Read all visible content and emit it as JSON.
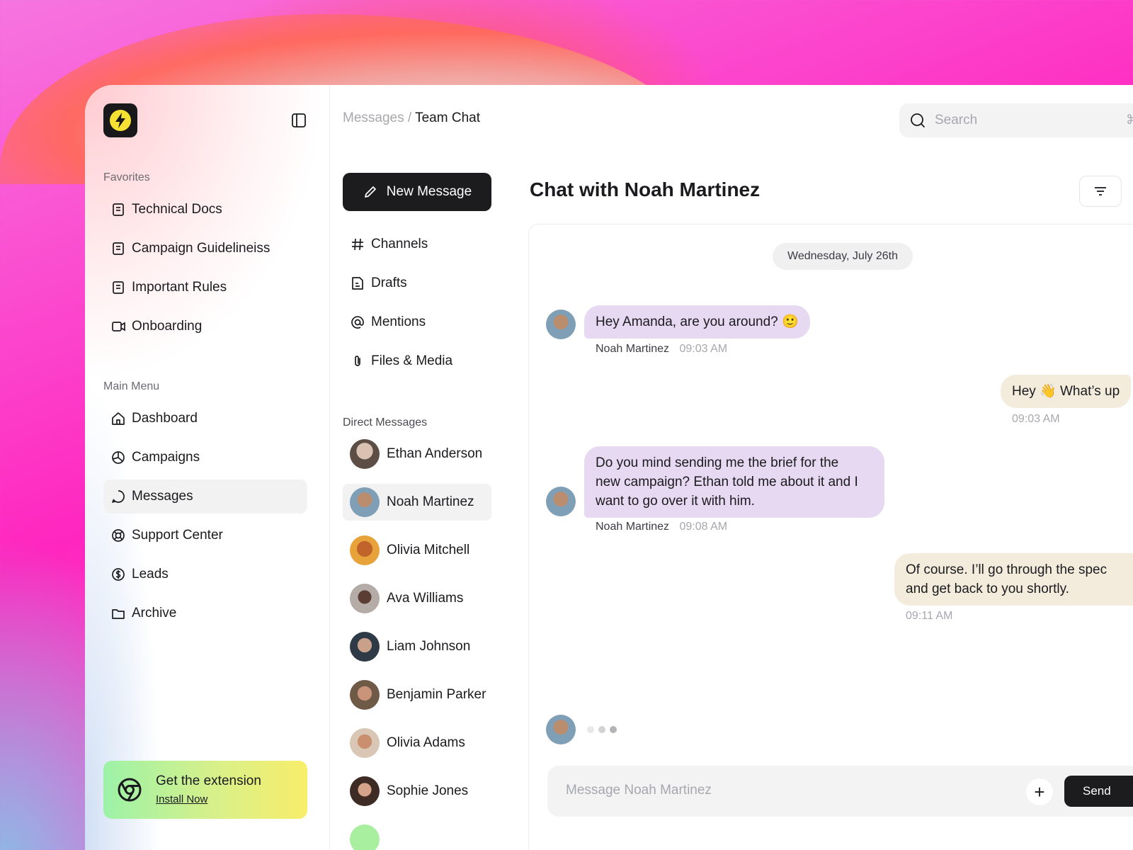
{
  "app": {
    "brand_colors": {
      "accent": "#1c1c1e",
      "logo_bolt": "#f7e233",
      "incoming_bubble": "#e7d9f1",
      "outgoing_bubble": "#f3ecdc"
    }
  },
  "sidebar": {
    "favorites_label": "Favorites",
    "favorites": [
      {
        "label": "Technical Docs",
        "icon": "document-icon"
      },
      {
        "label": "Campaign Guidelineiss",
        "icon": "document-icon"
      },
      {
        "label": "Important Rules",
        "icon": "document-icon"
      },
      {
        "label": "Onboarding",
        "icon": "video-icon"
      }
    ],
    "main_menu_label": "Main Menu",
    "main_menu": [
      {
        "label": "Dashboard",
        "icon": "home-icon"
      },
      {
        "label": "Campaigns",
        "icon": "pie-chart-icon"
      },
      {
        "label": "Messages",
        "icon": "chat-icon",
        "active": true
      },
      {
        "label": "Support Center",
        "icon": "lifebuoy-icon"
      },
      {
        "label": "Leads",
        "icon": "dollar-icon"
      },
      {
        "label": "Archive",
        "icon": "folder-icon"
      }
    ],
    "extension": {
      "title": "Get the extension",
      "link": "Install Now"
    }
  },
  "breadcrumb": {
    "parent": "Messages",
    "separator": "/",
    "current": "Team Chat"
  },
  "search": {
    "placeholder": "Search",
    "shortcut": "⌘ /"
  },
  "middle": {
    "new_message_label": "New Message",
    "items": [
      {
        "label": "Channels",
        "icon": "hash-icon"
      },
      {
        "label": "Drafts",
        "icon": "draft-icon"
      },
      {
        "label": "Mentions",
        "icon": "at-icon"
      },
      {
        "label": "Files & Media",
        "icon": "paperclip-icon"
      }
    ],
    "direct_messages_label": "Direct Messages",
    "direct_messages": [
      {
        "name": "Ethan Anderson",
        "avatar_color": "#8a7a70"
      },
      {
        "name": "Noah Martinez",
        "avatar_color": "#6f8fa6",
        "active": true
      },
      {
        "name": "Olivia Mitchell",
        "avatar_color": "#d97a2b"
      },
      {
        "name": "Ava Williams",
        "avatar_color": "#a49a95"
      },
      {
        "name": "Liam Johnson",
        "avatar_color": "#3e4a55"
      },
      {
        "name": "Benjamin Parker",
        "avatar_color": "#8d6e55"
      },
      {
        "name": "Olivia Adams",
        "avatar_color": "#b7906e"
      },
      {
        "name": "Sophie Jones",
        "avatar_color": "#6b4e45"
      }
    ]
  },
  "chat": {
    "title": "Chat with Noah Martinez",
    "date": "Wednesday, July 26th",
    "messages": [
      {
        "direction": "in",
        "text": "Hey Amanda, are you around? 🙂",
        "sender": "Noah Martinez",
        "time": "09:03 AM"
      },
      {
        "direction": "out",
        "text": "Hey 👋 What’s up",
        "time": "09:03 AM"
      },
      {
        "direction": "in",
        "lines": [
          "Do you mind sending me the brief for the",
          "new campaign? Ethan told me about it and I",
          "want to go over it with him."
        ],
        "sender": "Noah Martinez",
        "time": "09:08 AM"
      },
      {
        "direction": "out",
        "lines": [
          "Of course. I’ll go through the spec",
          "and get back to you shortly."
        ],
        "time": "09:11 AM"
      }
    ],
    "composer_placeholder": "Message Noah Martinez",
    "send_label": "Send"
  }
}
